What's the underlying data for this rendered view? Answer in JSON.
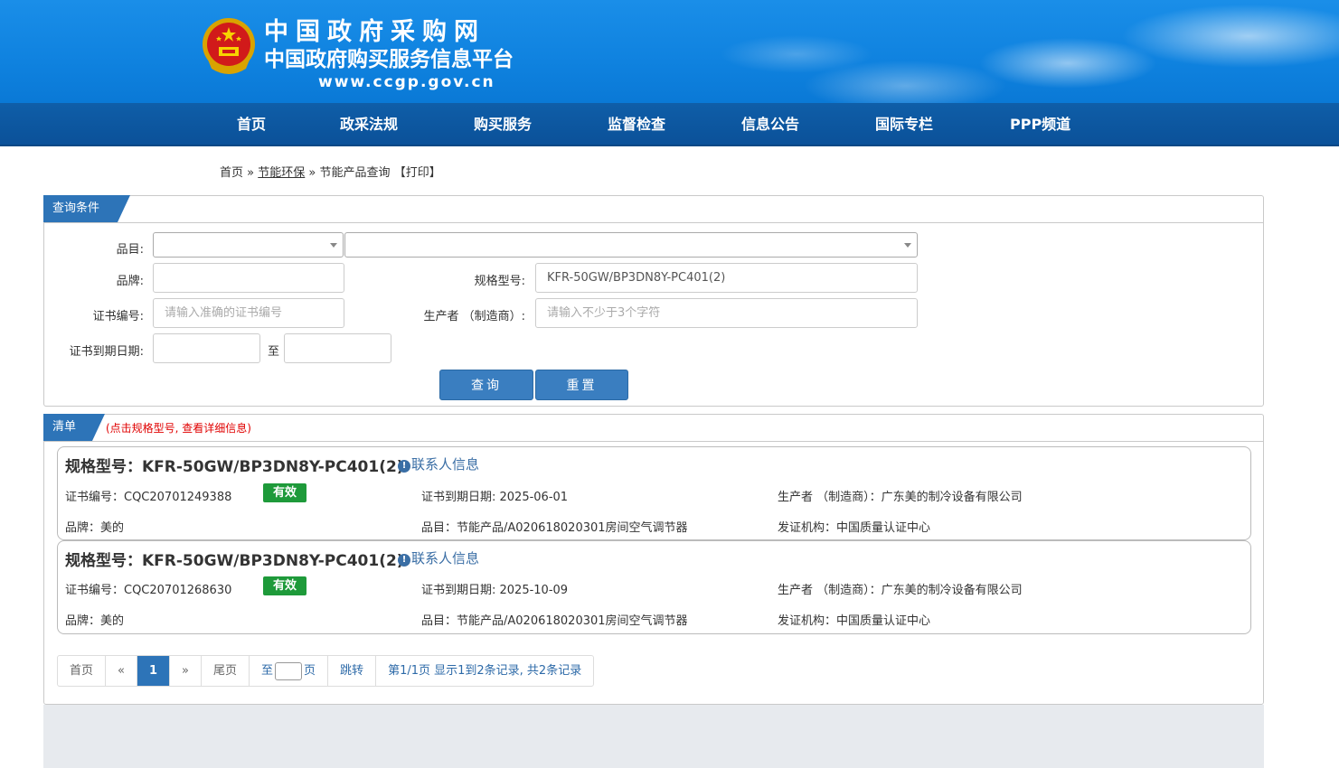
{
  "header": {
    "site_name": "中国政府采购网",
    "sub_name": "中国政府购买服务信息平台",
    "url": "www.ccgp.gov.cn"
  },
  "nav": {
    "items": [
      {
        "label": "首页"
      },
      {
        "label": "政采法规"
      },
      {
        "label": "购买服务"
      },
      {
        "label": "监督检查"
      },
      {
        "label": "信息公告"
      },
      {
        "label": "国际专栏"
      },
      {
        "label": "PPP频道"
      }
    ]
  },
  "breadcrumb": {
    "home": "首页",
    "sep1": "»",
    "section": "节能环保",
    "sep2": "»",
    "page": "节能产品查询",
    "print": "【打印】"
  },
  "query": {
    "tab_label": "查询条件",
    "category_label": "品目:",
    "category_value_1": "",
    "category_value_2": "",
    "brand_label": "品牌:",
    "brand_value": "",
    "model_label": "规格型号:",
    "model_value": "KFR-50GW/BP3DN8Y-PC401(2)",
    "cert_no_label": "证书编号:",
    "cert_no_placeholder": "请输入准确的证书编号",
    "manufacturer_label": "生产者 （制造商）:",
    "manufacturer_placeholder": "请输入不少于3个字符",
    "expiry_label": "证书到期日期:",
    "expiry_to": "至",
    "search_button": "查询",
    "reset_button": "重置"
  },
  "list": {
    "tab_label": "清单",
    "note": "(点击规格型号, 查看详细信息)",
    "items": [
      {
        "title": "规格型号：KFR-50GW/BP3DN8Y-PC401(2)",
        "contact": "联系人信息",
        "cert_no": "证书编号：CQC20701249388",
        "status": "有效",
        "expiry": "证书到期日期: 2025-06-01",
        "manufacturer": "生产者 （制造商）：广东美的制冷设备有限公司",
        "brand": "品牌：美的",
        "category": "品目：节能产品/A020618020301房间空气调节器",
        "issuer": "发证机构：中国质量认证中心"
      },
      {
        "title": "规格型号：KFR-50GW/BP3DN8Y-PC401(2)",
        "contact": "联系人信息",
        "cert_no": "证书编号：CQC20701268630",
        "status": "有效",
        "expiry": "证书到期日期: 2025-10-09",
        "manufacturer": "生产者 （制造商）：广东美的制冷设备有限公司",
        "brand": "品牌：美的",
        "category": "品目：节能产品/A020618020301房间空气调节器",
        "issuer": "发证机构：中国质量认证中心"
      }
    ]
  },
  "pager": {
    "first": "首页",
    "prev": "«",
    "current": "1",
    "next": "»",
    "last": "尾页",
    "goto_prefix": "至",
    "goto_suffix": "页",
    "jump": "跳转",
    "summary": "第1/1页  显示1到2条记录, 共2条记录"
  },
  "colors": {
    "banner_blue": "#1a8ee8",
    "nav_blue": "#0f5ea8",
    "tab_blue": "#2d74b8",
    "valid_green": "#1e9a3a",
    "note_red": "#e00000"
  }
}
